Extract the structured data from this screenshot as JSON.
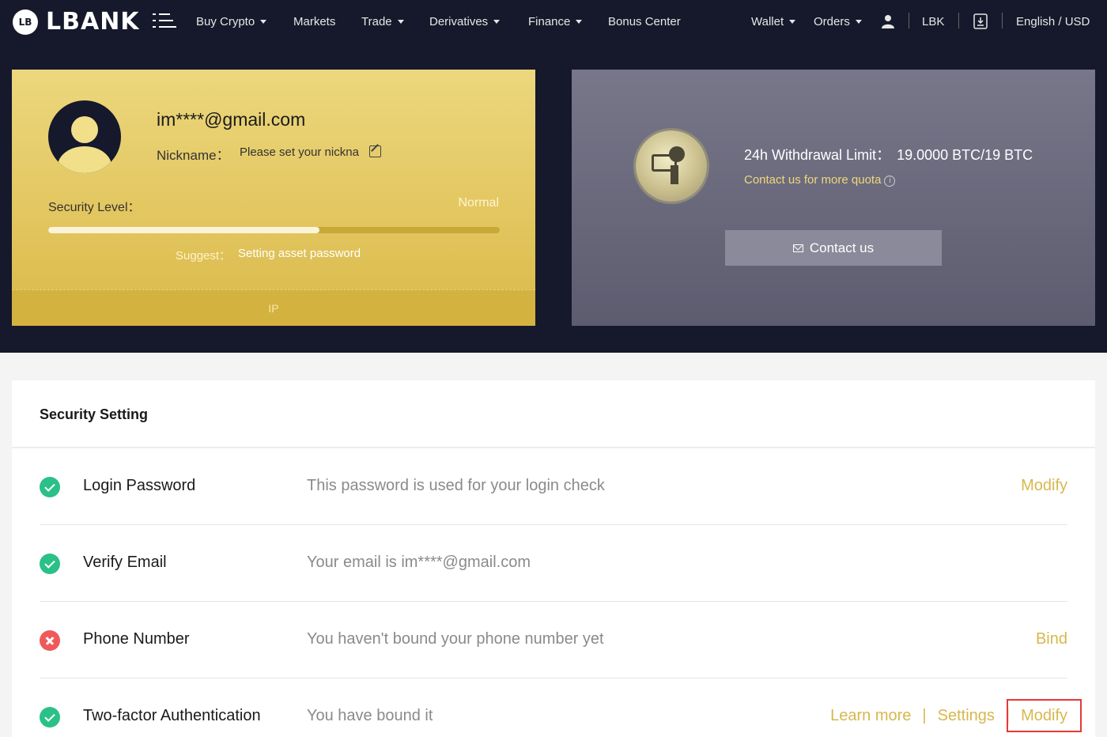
{
  "nav": {
    "logo_mark": "LB",
    "logo_text": "LBANK",
    "items": [
      {
        "label": "Buy Crypto",
        "caret": true
      },
      {
        "label": "Markets",
        "caret": false
      },
      {
        "label": "Trade",
        "caret": true
      },
      {
        "label": "Derivatives",
        "caret": true
      },
      {
        "label": "Finance",
        "caret": true
      },
      {
        "label": "Bonus Center",
        "caret": false
      }
    ],
    "right": {
      "wallet": "Wallet",
      "orders": "Orders",
      "token": "LBK",
      "lang": "English / USD"
    }
  },
  "account": {
    "email": "im****@gmail.com",
    "nickname_label": "Nickname：",
    "nickname_value": "Please set your nickna",
    "security_label": "Security Level：",
    "security_value": "Normal",
    "security_progress": 0.6,
    "suggest_label": "Suggest：",
    "suggest_value": "Setting asset password",
    "footer": "IP"
  },
  "withdrawal": {
    "label": "24h Withdrawal Limit：",
    "value": "19.0000 BTC/19 BTC",
    "quota_link": "Contact us for more quota",
    "info_glyph": "i",
    "contact_button": "Contact us"
  },
  "security": {
    "title": "Security Setting",
    "rows": [
      {
        "name": "Login Password",
        "desc": "This password is used for your login check",
        "status": "ok",
        "actions": [
          "Modify"
        ]
      },
      {
        "name": "Verify Email",
        "desc": "Your email is im****@gmail.com",
        "status": "ok",
        "actions": []
      },
      {
        "name": "Phone Number",
        "desc": "You haven't bound your phone number yet",
        "status": "bad",
        "actions": [
          "Bind"
        ]
      },
      {
        "name": "Two-factor Authentication",
        "desc": "You have bound it",
        "status": "ok",
        "actions": [
          "Learn more",
          "Settings",
          "Modify"
        ]
      }
    ],
    "action_separator": "|"
  },
  "colors": {
    "nav_bg": "#15192b",
    "gold": "#e2c55e",
    "accent": "#d8b74e",
    "ok": "#2bc088",
    "error": "#ee5a5a",
    "highlight": "#e53935"
  }
}
